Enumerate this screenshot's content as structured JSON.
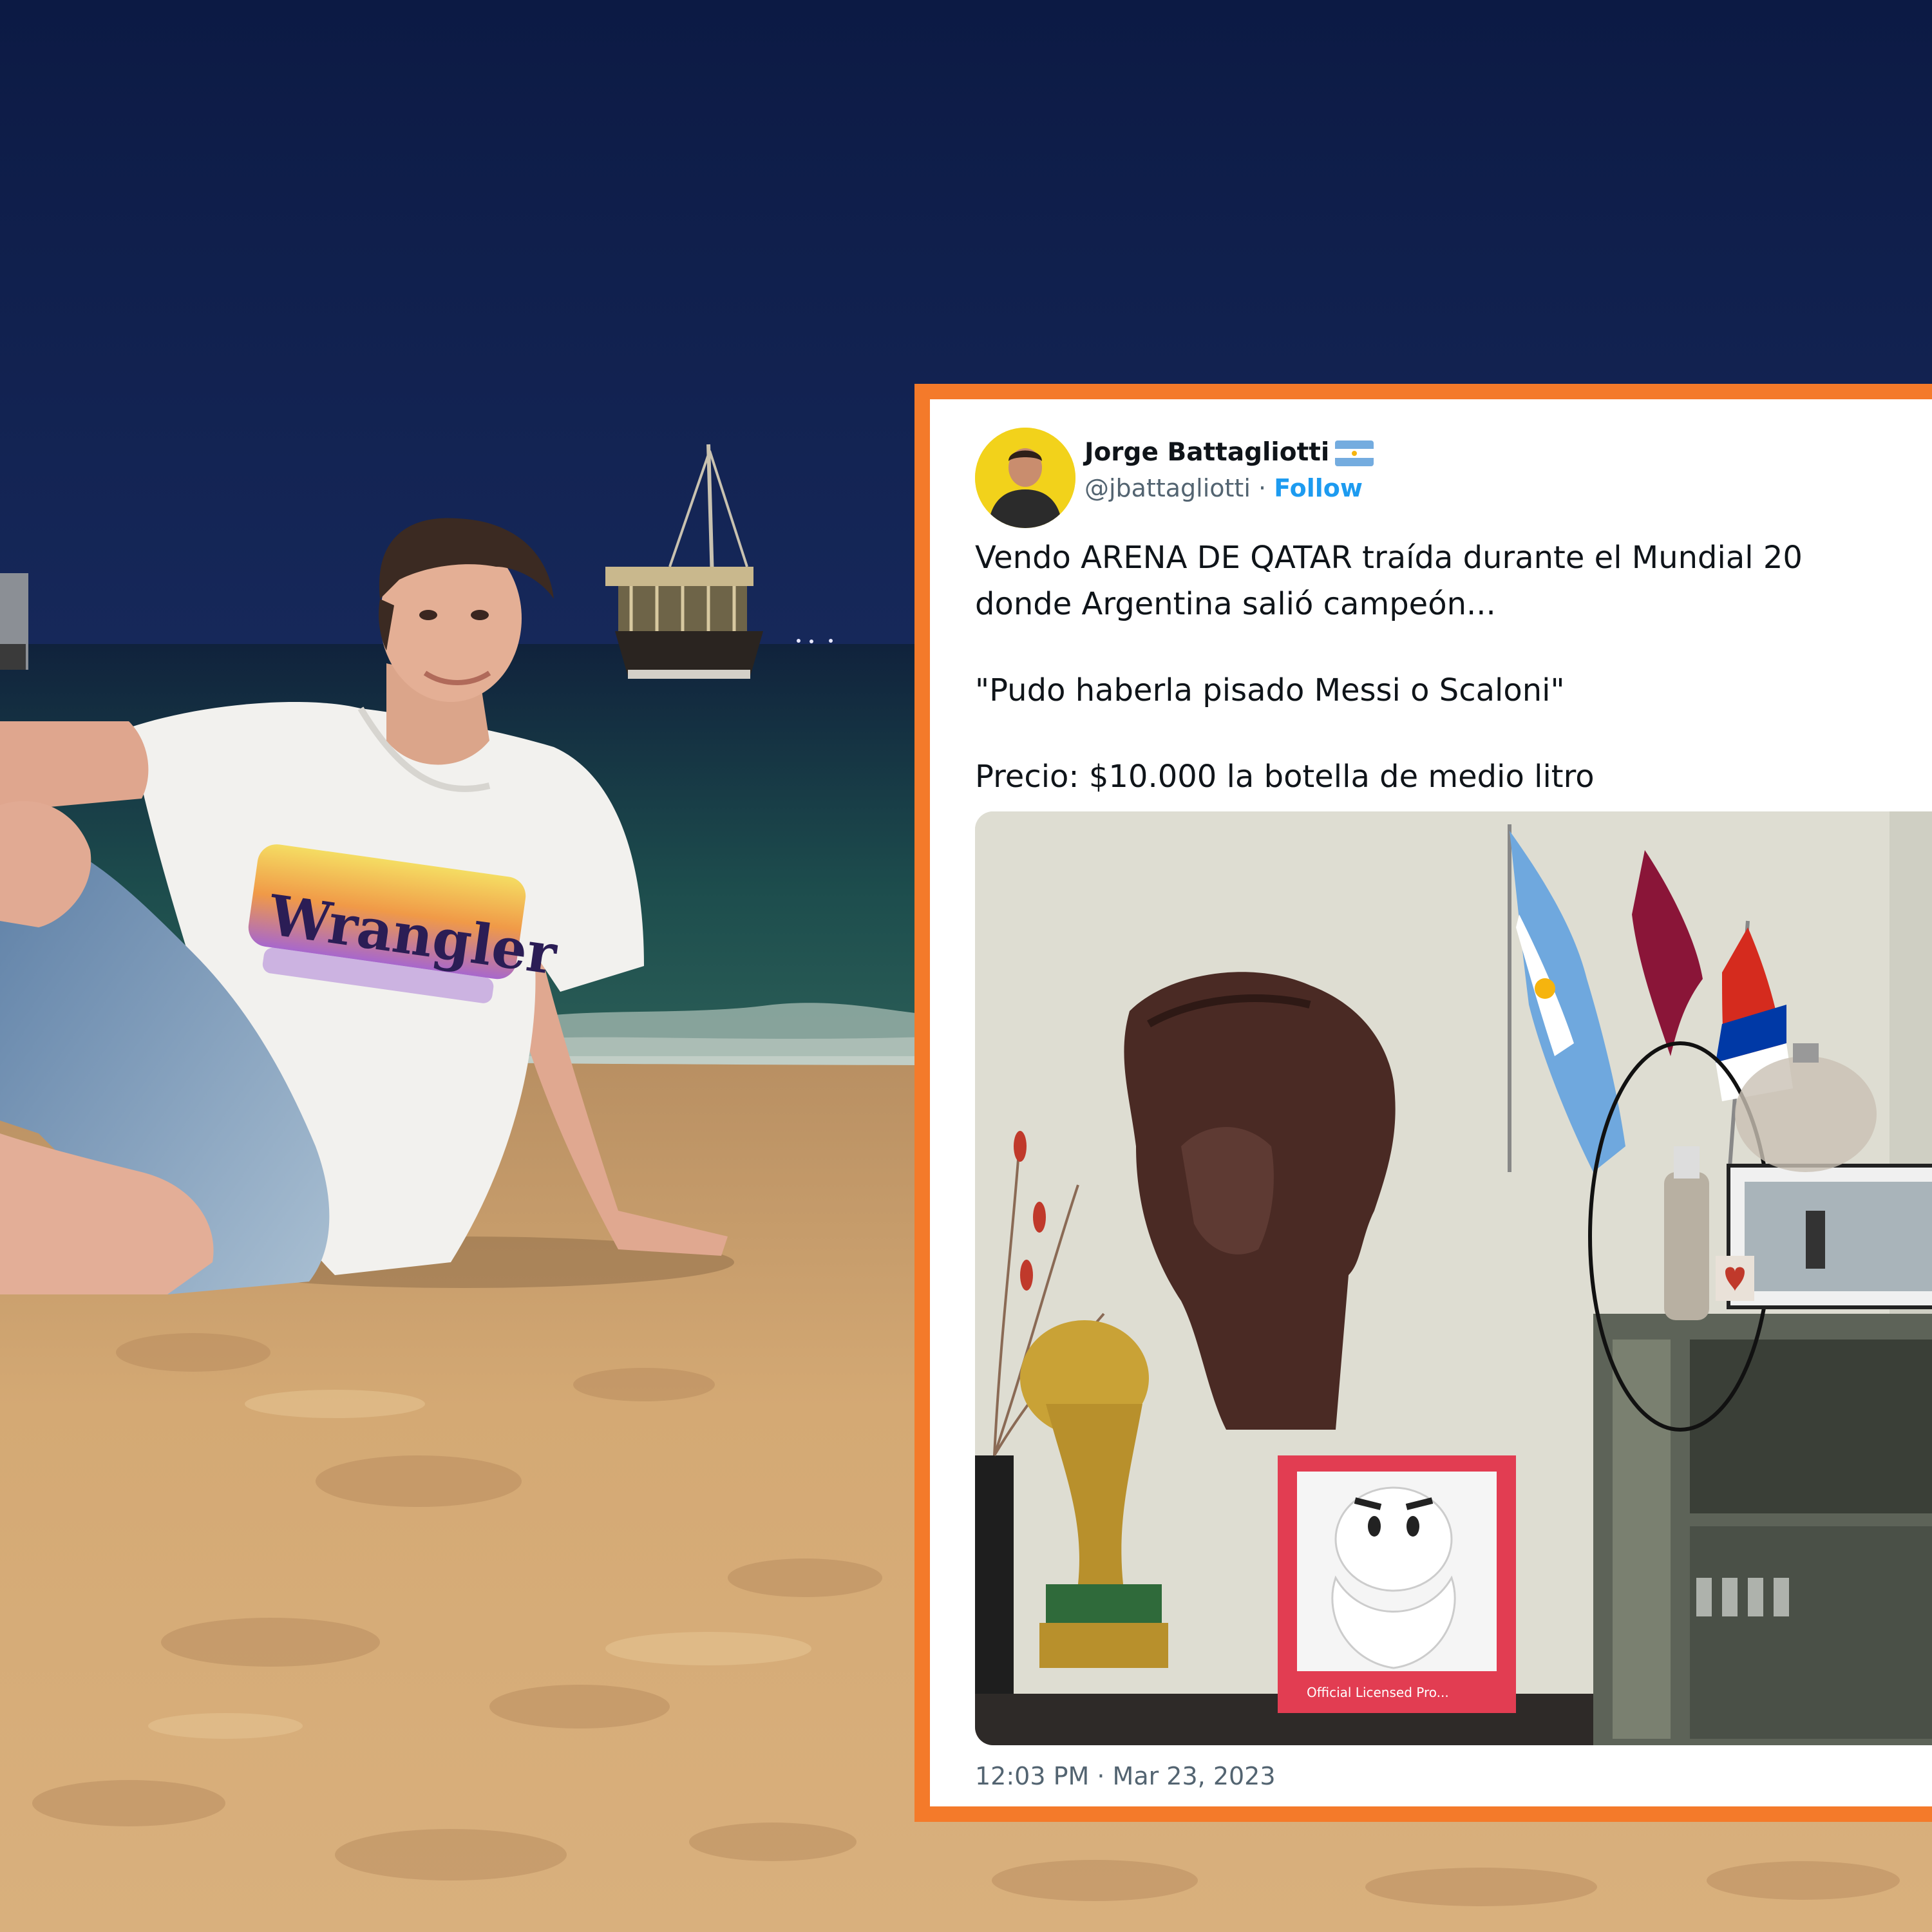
{
  "tweet": {
    "display_name": "Jorge Battagliotti",
    "handle": "@jbattagliotti",
    "separator": "·",
    "follow_label": "Follow",
    "lines": [
      "Vendo ARENA DE QATAR traída durante el Mundial 20",
      "donde Argentina salió campeón...",
      "\"Pudo haberla pisado Messi o Scaloni\"",
      "Precio: $10.000 la botella de medio litro"
    ],
    "timestamp": "12:03 PM · Mar 23, 2023"
  },
  "photo": {
    "shirt_text": "Wrangler"
  },
  "media": {
    "box_label": "Official Licensed Pro..."
  },
  "colors": {
    "card_border": "#f47a2a",
    "follow_link": "#1d9bf0",
    "sky": "#0d1c45",
    "sand": "#d6aa72"
  }
}
